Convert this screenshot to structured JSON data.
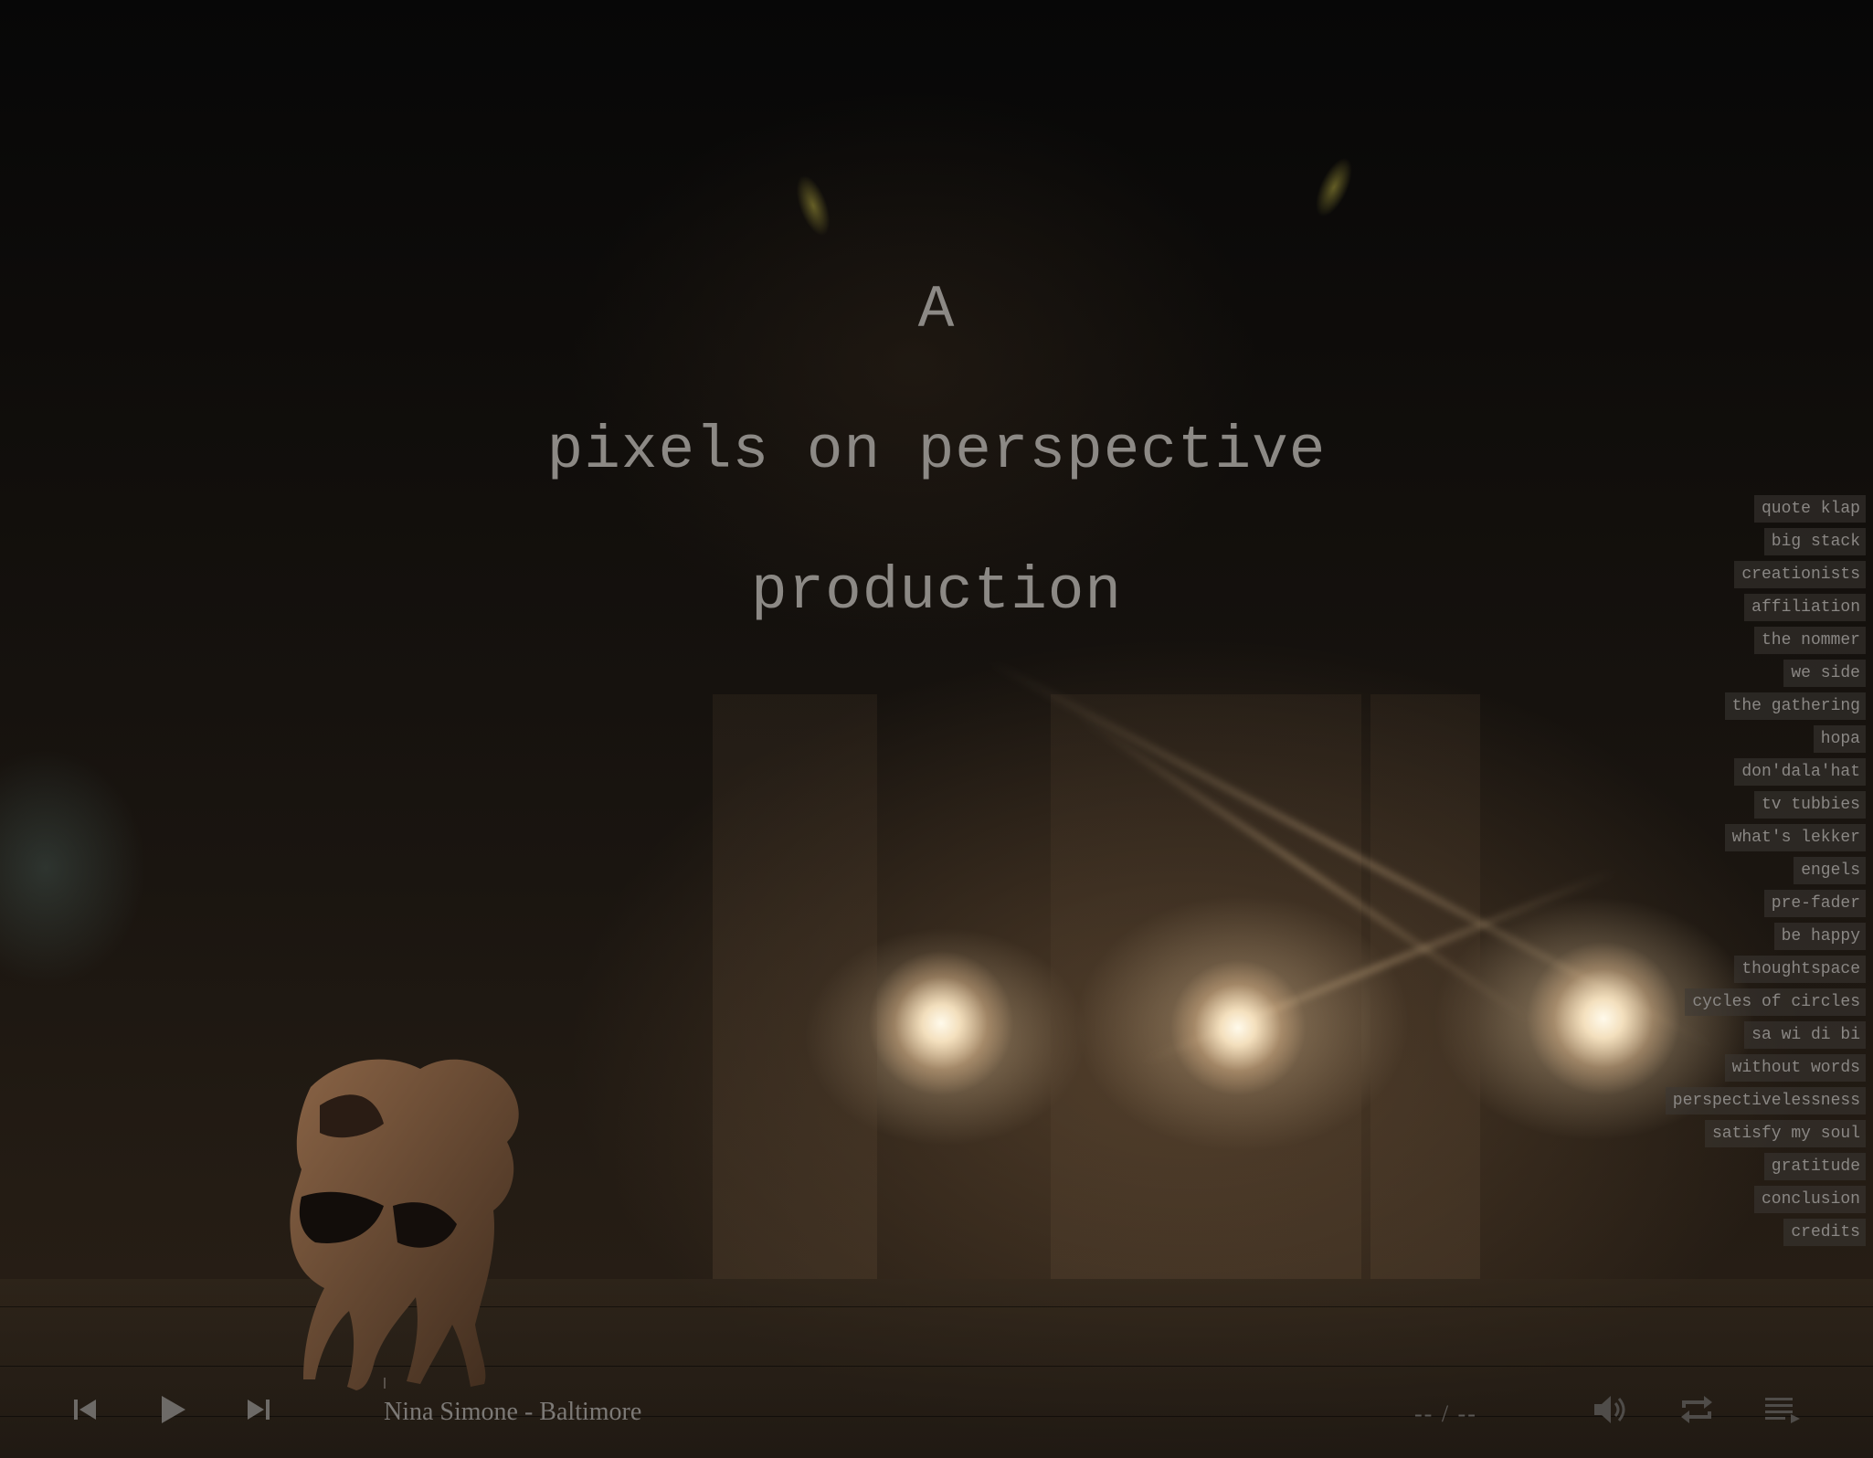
{
  "title": {
    "line1": "A",
    "line2": "pixels on perspective",
    "line3": "production"
  },
  "nav": {
    "items": [
      {
        "label": "quote klap"
      },
      {
        "label": "big stack"
      },
      {
        "label": "creationists"
      },
      {
        "label": "affiliation"
      },
      {
        "label": "the nommer"
      },
      {
        "label": "we side"
      },
      {
        "label": "the gathering"
      },
      {
        "label": "hopa"
      },
      {
        "label": "don'dala'hat"
      },
      {
        "label": "tv tubbies"
      },
      {
        "label": "what's lekker"
      },
      {
        "label": "engels"
      },
      {
        "label": "pre-fader"
      },
      {
        "label": "be happy"
      },
      {
        "label": "thoughtspace"
      },
      {
        "label": "cycles of circles"
      },
      {
        "label": "sa wi di bi"
      },
      {
        "label": "without words"
      },
      {
        "label": "perspectivelessness"
      },
      {
        "label": "satisfy my soul"
      },
      {
        "label": "gratitude"
      },
      {
        "label": "conclusion"
      },
      {
        "label": "credits"
      }
    ]
  },
  "player": {
    "track": "Nina Simone - Baltimore",
    "time": "-- / --",
    "icons": {
      "previous": "skip-previous-icon",
      "play": "play-icon",
      "next": "skip-next-icon",
      "volume": "volume-icon",
      "repeat": "repeat-icon",
      "playlist": "playlist-icon"
    }
  },
  "colors": {
    "text": "#8c8985",
    "controls": "#6d6a67",
    "nav_bg": "#3c3834"
  }
}
